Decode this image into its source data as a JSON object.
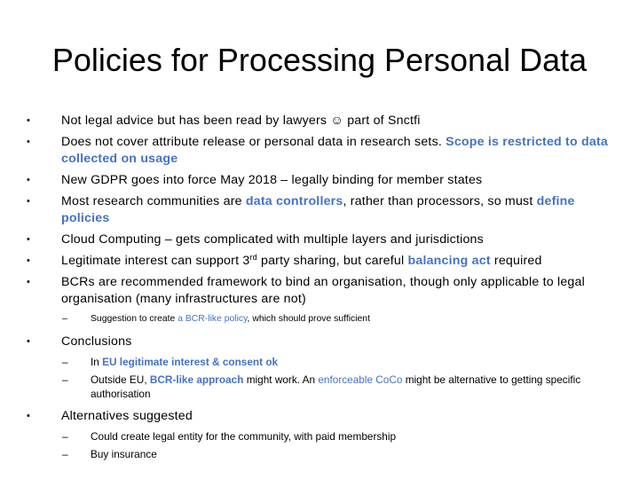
{
  "slide": {
    "title": "Policies for Processing Personal Data",
    "bullets": [
      {
        "segments": [
          {
            "text": "Not legal advice but has been read by lawyers ",
            "highlight": false
          },
          {
            "text": "☺",
            "highlight": false,
            "icon": "smiley-icon"
          },
          {
            "text": " part of Snctfi",
            "highlight": false
          }
        ]
      },
      {
        "segments": [
          {
            "text": "Does not cover attribute release or personal data in research sets. ",
            "highlight": false
          },
          {
            "text": "Scope is restricted to data collected on usage",
            "highlight": true
          }
        ]
      },
      {
        "segments": [
          {
            "text": "New GDPR goes into force May 2018 – legally binding for member states",
            "highlight": false
          }
        ]
      },
      {
        "segments": [
          {
            "text": "Most research communities are ",
            "highlight": false
          },
          {
            "text": "data controllers",
            "highlight": true
          },
          {
            "text": ", rather than processors, so must ",
            "highlight": false
          },
          {
            "text": "define policies",
            "highlight": true
          }
        ]
      },
      {
        "segments": [
          {
            "text": "Cloud Computing – gets complicated with multiple layers and jurisdictions",
            "highlight": false
          }
        ]
      },
      {
        "segments": [
          {
            "text": "Legitimate interest can support 3",
            "highlight": false
          },
          {
            "text": "rd",
            "highlight": false,
            "superscript": true
          },
          {
            "text": " party sharing, but careful ",
            "highlight": false
          },
          {
            "text": "balancing act",
            "highlight": true
          },
          {
            "text": " required",
            "highlight": false
          }
        ]
      },
      {
        "segments": [
          {
            "text": "BCRs are recommended framework to bind an organisation, though only applicable to legal organisation (many infrastructures are not)",
            "highlight": false
          }
        ],
        "sub": [
          {
            "segments": [
              {
                "text": "Suggestion to create ",
                "highlight": false
              },
              {
                "text": "a BCR-like policy",
                "highlight": true
              },
              {
                "text": ", which should prove sufficient",
                "highlight": false
              }
            ]
          }
        ]
      },
      {
        "segments": [
          {
            "text": "Conclusions",
            "highlight": false
          }
        ],
        "sub": [
          {
            "segments": [
              {
                "text": "In ",
                "highlight": false
              },
              {
                "text": "EU legitimate interest & consent ok",
                "highlight": true
              }
            ]
          },
          {
            "segments": [
              {
                "text": "Outside EU, ",
                "highlight": false
              },
              {
                "text": "BCR-like approach",
                "highlight": true
              },
              {
                "text": " might work. An ",
                "highlight": false
              },
              {
                "text": "enforceable CoCo",
                "highlight": true
              },
              {
                "text": " might be alternative to getting specific authorisation",
                "highlight": false
              }
            ]
          }
        ]
      },
      {
        "segments": [
          {
            "text": "Alternatives suggested",
            "highlight": false
          }
        ],
        "sub": [
          {
            "segments": [
              {
                "text": "Could create legal entity for the community, with paid membership",
                "highlight": false
              }
            ]
          },
          {
            "segments": [
              {
                "text": "Buy insurance",
                "highlight": false
              }
            ]
          }
        ]
      }
    ],
    "bullet_glyph": "•",
    "dash_glyph": "–",
    "colors": {
      "text": "#000000",
      "highlight": "#4472c4",
      "background": "#ffffff"
    }
  }
}
